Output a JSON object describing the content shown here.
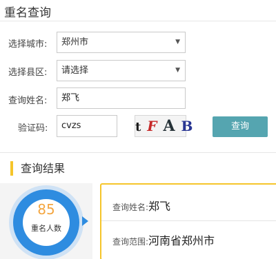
{
  "page": {
    "title": "重名查询"
  },
  "form": {
    "city_label": "选择城市:",
    "city_value": "郑州市",
    "county_label": "选择县区:",
    "county_value": "请选择",
    "name_label": "查询姓名:",
    "name_value": "郑飞",
    "code_label": "验证码:",
    "code_value": "cvzs",
    "captcha_chars": [
      "t",
      "F",
      "A",
      "B"
    ],
    "submit_label": "查询"
  },
  "result": {
    "section_title": "查询结果",
    "count": "85",
    "count_label": "重名人数",
    "name_label": "查询姓名:",
    "name_value": "郑飞",
    "scope_label": "查询范围:",
    "scope_value": "河南省郑州市"
  },
  "icons": {
    "select_caret": "caret-down-icon"
  },
  "colors": {
    "accent_button": "#55a5b0",
    "highlight": "#f5c52a",
    "ring": "#2e8ce0",
    "count": "#f4a640"
  }
}
